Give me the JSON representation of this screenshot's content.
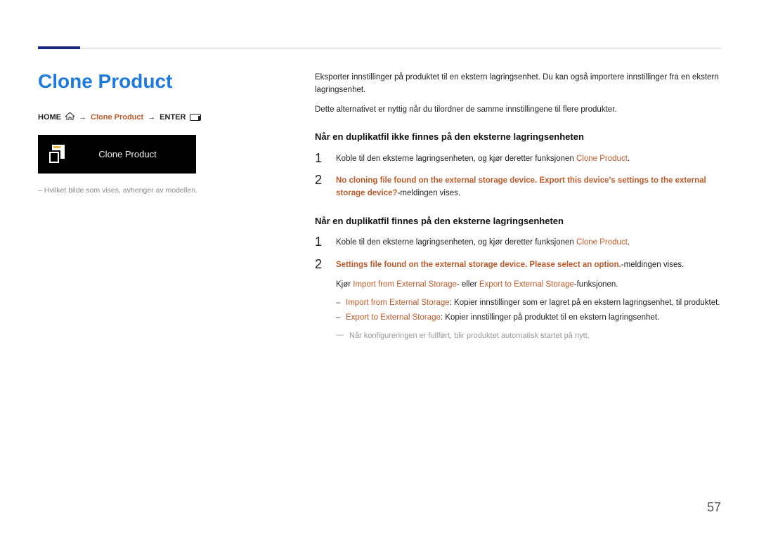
{
  "page_number": "57",
  "left": {
    "title": "Clone Product",
    "breadcrumb": {
      "home": "HOME",
      "arrow": "→",
      "product": "Clone Product",
      "enter": "ENTER"
    },
    "tile_label": "Clone Product",
    "footnote": "Hvilket bilde som vises, avhenger av modellen."
  },
  "right": {
    "intro1": "Eksporter innstillinger på produktet til en ekstern lagringsenhet. Du kan også importere innstillinger fra en ekstern lagringsenhet.",
    "intro2": "Dette alternativet er nyttig når du tilordner de samme innstillingene til flere produkter.",
    "sec1": {
      "heading": "Når en duplikatfil ikke finnes på den eksterne lagringsenheten",
      "step1_pre": "Koble til den eksterne lagringsenheten, og kjør deretter funksjonen ",
      "step1_hl": "Clone Product",
      "step1_post": ".",
      "step2_hl": "No cloning file found on the external storage device. Export this device's settings to the external storage device?",
      "step2_post": "-meldingen vises."
    },
    "sec2": {
      "heading": "Når en duplikatfil finnes på den eksterne lagringsenheten",
      "step1_pre": "Koble til den eksterne lagringsenheten, og kjør deretter funksjonen ",
      "step1_hl": "Clone Product",
      "step1_post": ".",
      "step2_hl": "Settings file found on the external storage device. Please select an option.",
      "step2_post": "-meldingen vises.",
      "kjor_pre": "Kjør ",
      "kjor_a": "Import from External Storage",
      "kjor_mid": "- eller ",
      "kjor_b": "Export to External Storage",
      "kjor_post": "-funksjonen.",
      "li1_hl": "Import from External Storage",
      "li1_txt": ": Kopier innstillinger som er lagret på en ekstern lagringsenhet, til produktet.",
      "li2_hl": "Export to External Storage",
      "li2_txt": ": Kopier innstillinger på produktet til en ekstern lagringsenhet.",
      "tip": "Når konfigureringen er fullført, blir produktet automatisk startet på nytt."
    }
  }
}
